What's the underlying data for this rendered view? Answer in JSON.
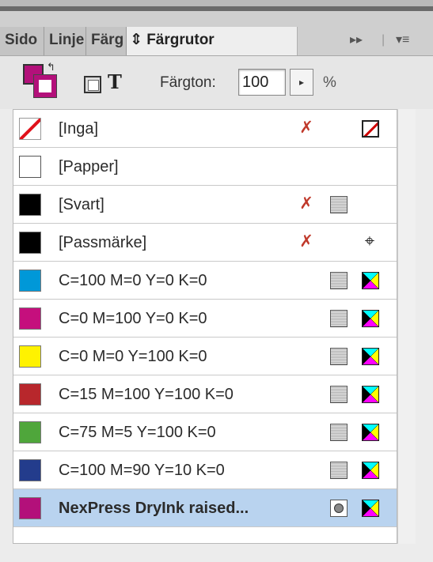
{
  "tabs": [
    {
      "label": "Sido",
      "active": false
    },
    {
      "label": "Linje",
      "active": false
    },
    {
      "label": "Färg",
      "active": false
    },
    {
      "label": "⇕ Färgrutor",
      "active": true
    }
  ],
  "panel_controls": {
    "expand": "▸▸",
    "menu": "▾≡"
  },
  "toolbar": {
    "text_glyph": "T",
    "tint_label": "Färgton:",
    "tint_value": "100",
    "stepper_glyph": "▸",
    "percent": "%"
  },
  "colors": {
    "accent_fill": "#b3107a",
    "selection": "#b9d3ef"
  },
  "swatches": [
    {
      "name": "[Inga]",
      "color": "none",
      "edit_lock": true,
      "type_icon": "none-icon",
      "selected": false
    },
    {
      "name": "[Papper]",
      "color": "#ffffff",
      "edit_lock": false,
      "type_icon": "",
      "selected": false
    },
    {
      "name": "[Svart]",
      "color": "#000000",
      "edit_lock": true,
      "type_icon": "process-icon",
      "selected": false
    },
    {
      "name": "[Passmärke]",
      "color": "#000000",
      "edit_lock": true,
      "type_icon": "registration-icon",
      "selected": false
    },
    {
      "name": "C=100 M=0 Y=0 K=0",
      "color": "#0098d8",
      "edit_lock": false,
      "type_icon": "process-cmyk",
      "selected": false
    },
    {
      "name": "C=0 M=100 Y=0 K=0",
      "color": "#c50f7d",
      "edit_lock": false,
      "type_icon": "process-cmyk",
      "selected": false
    },
    {
      "name": "C=0 M=0 Y=100 K=0",
      "color": "#fff200",
      "edit_lock": false,
      "type_icon": "process-cmyk",
      "selected": false
    },
    {
      "name": "C=15 M=100 Y=100 K=0",
      "color": "#b8272c",
      "edit_lock": false,
      "type_icon": "process-cmyk",
      "selected": false
    },
    {
      "name": "C=75 M=5 Y=100 K=0",
      "color": "#4fa63b",
      "edit_lock": false,
      "type_icon": "process-cmyk",
      "selected": false
    },
    {
      "name": "C=100 M=90 Y=10 K=0",
      "color": "#233c8c",
      "edit_lock": false,
      "type_icon": "process-cmyk",
      "selected": false
    },
    {
      "name": "NexPress DryInk raised...",
      "color": "#b3107a",
      "edit_lock": false,
      "type_icon": "spot-cmyk",
      "selected": true
    }
  ]
}
